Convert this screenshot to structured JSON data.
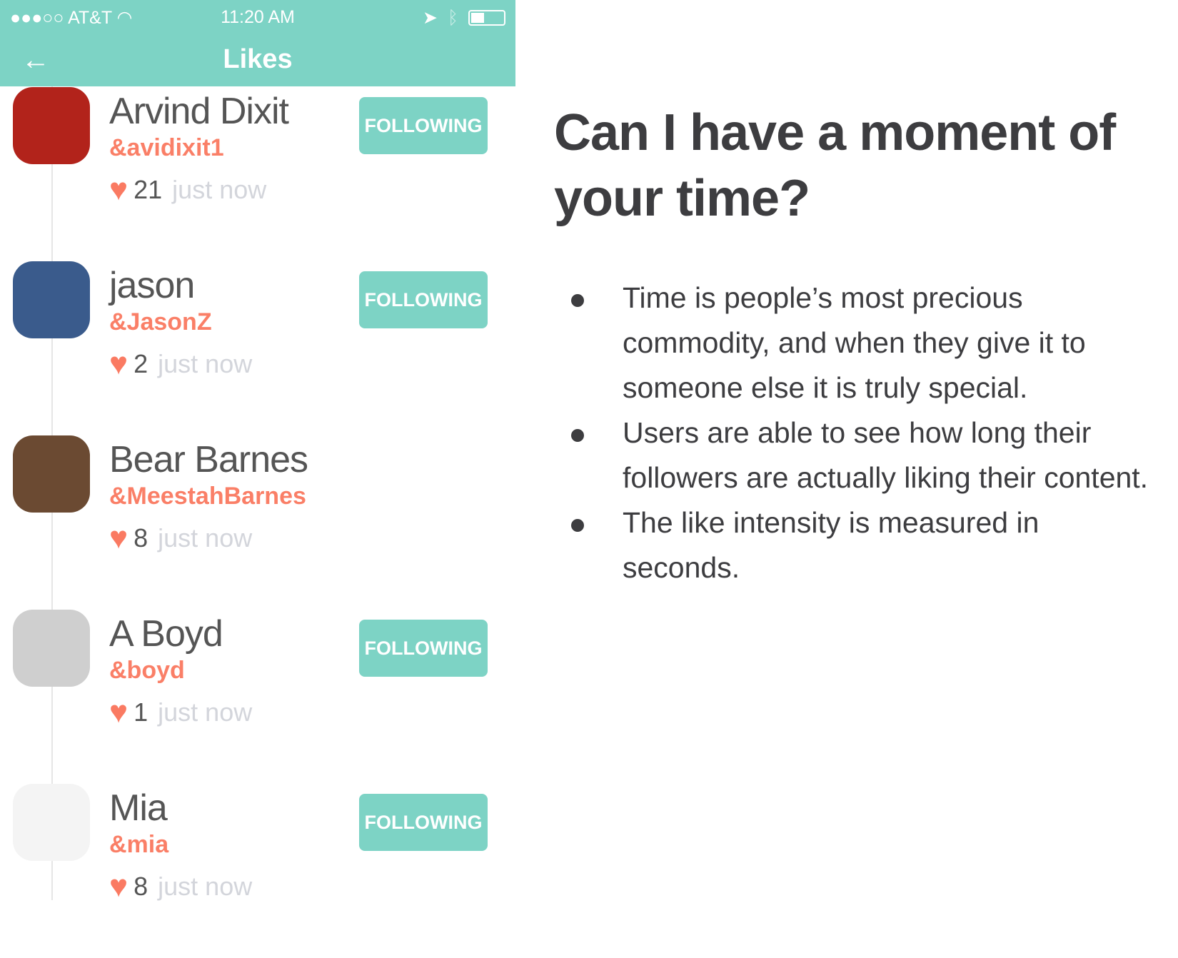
{
  "status_bar": {
    "signal": "●●●○○",
    "carrier": "AT&T",
    "time": "11:20 AM",
    "battery_level": 0.4
  },
  "nav": {
    "title": "Likes",
    "back_icon": "arrow-left-icon"
  },
  "colors": {
    "accent": "#7dd3c5",
    "handle": "#fa7f67",
    "heart": "#fa7a62"
  },
  "likes": [
    {
      "name": "Arvind Dixit",
      "handle": "&avidixit1",
      "count": "21",
      "time": "just now",
      "button": "FOLLOWING",
      "avatar": "#b2231b"
    },
    {
      "name": "jason",
      "handle": "&JasonZ",
      "count": "2",
      "time": "just now",
      "button": "FOLLOWING",
      "avatar": "#3a5b8c"
    },
    {
      "name": "Bear Barnes",
      "handle": "&MeestahBarnes",
      "count": "8",
      "time": "just now",
      "button": "",
      "avatar": "#6b4a32"
    },
    {
      "name": "A Boyd",
      "handle": "&boyd",
      "count": "1",
      "time": "just now",
      "button": "FOLLOWING",
      "avatar": "#cfcfcf"
    },
    {
      "name": "Mia",
      "handle": "&mia",
      "count": "8",
      "time": "just now",
      "button": "FOLLOWING",
      "avatar": "#f4f4f4"
    }
  ],
  "slide": {
    "title": "Can I have a moment of your time?",
    "bullets": [
      "Time is people’s most precious commodity, and when they give it to someone else it is truly special.",
      "Users are able to see how long their followers are actually liking their content.",
      "The like intensity is measured in seconds."
    ]
  }
}
